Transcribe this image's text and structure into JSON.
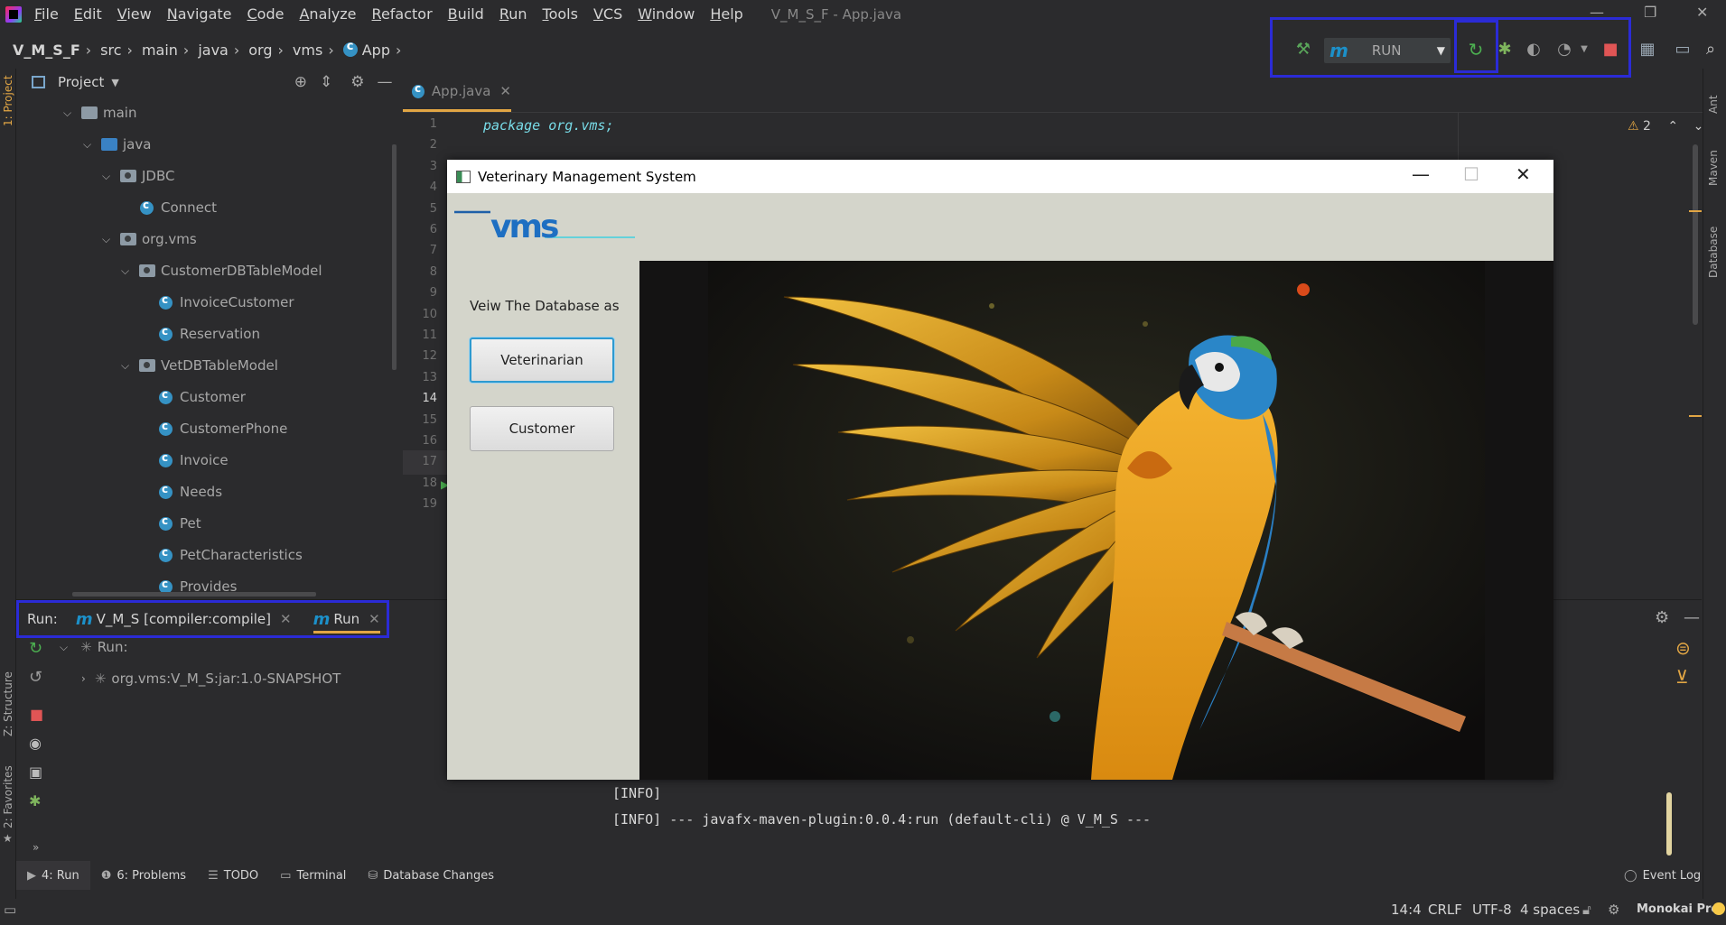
{
  "menu": {
    "items": [
      "File",
      "Edit",
      "View",
      "Navigate",
      "Code",
      "Analyze",
      "Refactor",
      "Build",
      "Run",
      "Tools",
      "VCS",
      "Window",
      "Help"
    ],
    "window_title": "V_M_S_F - App.java"
  },
  "breadcrumb": [
    "V_M_S_F",
    "src",
    "main",
    "java",
    "org",
    "vms",
    "App"
  ],
  "toolbar": {
    "run_config_label": "RUN",
    "icons": [
      "build-hammer-icon",
      "rerun-icon",
      "debug-icon",
      "coverage-icon",
      "profile-icon",
      "stop-icon",
      "project-structure-icon",
      "terminal-icon",
      "search-icon"
    ]
  },
  "project_panel": {
    "title": "Project",
    "tree": [
      {
        "label": "main",
        "kind": "folder"
      },
      {
        "label": "java",
        "kind": "folder-blue"
      },
      {
        "label": "JDBC",
        "kind": "package"
      },
      {
        "label": "Connect",
        "kind": "class"
      },
      {
        "label": "org.vms",
        "kind": "package"
      },
      {
        "label": "CustomerDBTableModel",
        "kind": "package"
      },
      {
        "label": "InvoiceCustomer",
        "kind": "class"
      },
      {
        "label": "Reservation",
        "kind": "class"
      },
      {
        "label": "VetDBTableModel",
        "kind": "package"
      },
      {
        "label": "Customer",
        "kind": "class"
      },
      {
        "label": "CustomerPhone",
        "kind": "class"
      },
      {
        "label": "Invoice",
        "kind": "class"
      },
      {
        "label": "Needs",
        "kind": "class"
      },
      {
        "label": "Pet",
        "kind": "class"
      },
      {
        "label": "PetCharacteristics",
        "kind": "class"
      },
      {
        "label": "Provides",
        "kind": "class"
      }
    ]
  },
  "editor": {
    "tab_label": "App.java",
    "code_first_line": "package org.vms;",
    "line_numbers": [
      "1",
      "2",
      "3",
      "4",
      "5",
      "6",
      "7",
      "8",
      "9",
      "10",
      "11",
      "12",
      "13",
      "14",
      "15",
      "16",
      "17",
      "18",
      "19"
    ],
    "current_line": "14",
    "warning_count": "2"
  },
  "left_stripe": {
    "project": "1: Project",
    "structure": "Z: Structure",
    "favorites": "2: Favorites"
  },
  "right_stripe": {
    "ant": "Ant",
    "maven": "Maven",
    "database": "Database"
  },
  "run_panel": {
    "label": "Run:",
    "tabs": [
      "V_M_S [compiler:compile]",
      "Run"
    ],
    "tree_root": "Run:",
    "tree_child": "org.vms:V_M_S:jar:1.0-SNAPSHOT",
    "console_lines": [
      "[INFO]",
      "[INFO] --- javafx-maven-plugin:0.0.4:run (default-cli) @ V_M_S ---"
    ]
  },
  "bottom_tabs": [
    {
      "label": "4: Run",
      "icon": "run-icon"
    },
    {
      "label": "6: Problems",
      "icon": "problems-icon"
    },
    {
      "label": "TODO",
      "icon": "todo-icon"
    },
    {
      "label": "Terminal",
      "icon": "terminal-icon"
    },
    {
      "label": "Database Changes",
      "icon": "database-changes-icon"
    },
    {
      "label": "Event Log",
      "icon": "event-log-icon"
    }
  ],
  "status": {
    "position": "14:4",
    "line_sep": "CRLF",
    "encoding": "UTF-8",
    "indent": "4 spaces",
    "theme": "Monokai Pro"
  },
  "app_window": {
    "title": "Veterinary Management System",
    "logo_text": "vms",
    "prompt": "Veiw The Database as",
    "button_vet": "Veterinarian",
    "button_customer": "Customer"
  },
  "colors": {
    "accent": "#e2a644",
    "highlight_box": "#2b2bd6",
    "class_icon": "#3592c4",
    "maven": "#1c90c9",
    "stop": "#e05555",
    "rerun": "#4caf50"
  }
}
